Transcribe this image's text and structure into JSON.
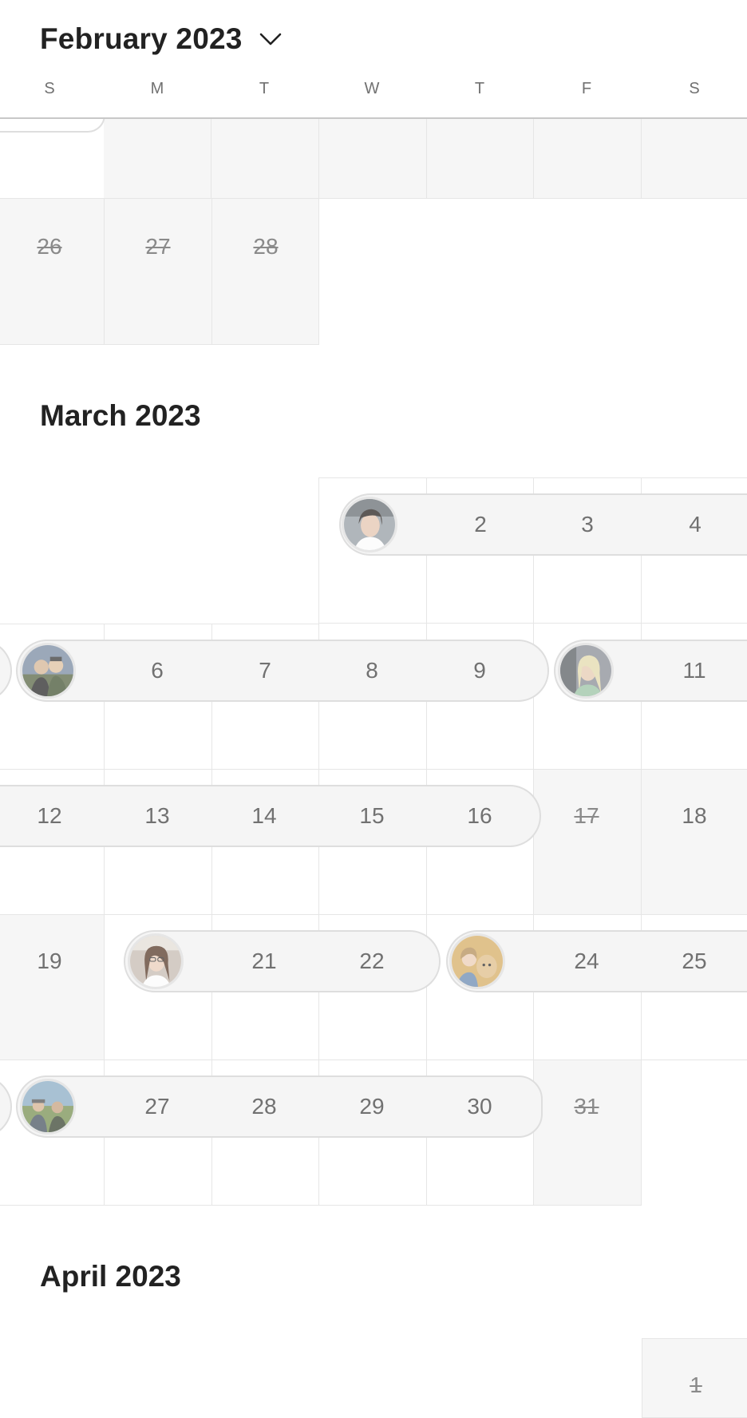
{
  "header": {
    "current_month": "February 2023",
    "weekdays": [
      "S",
      "M",
      "T",
      "W",
      "T",
      "F",
      "S"
    ]
  },
  "months": {
    "february": {
      "title": "",
      "days": [
        "26",
        "27",
        "28"
      ]
    },
    "march": {
      "title": "March 2023",
      "days": {
        "d2": "2",
        "d3": "3",
        "d4": "4",
        "d6": "6",
        "d7": "7",
        "d8": "8",
        "d9": "9",
        "d11": "11",
        "d12": "12",
        "d13": "13",
        "d14": "14",
        "d15": "15",
        "d16": "16",
        "d17": "17",
        "d18": "18",
        "d19": "19",
        "d21": "21",
        "d22": "22",
        "d24": "24",
        "d25": "25",
        "d27": "27",
        "d28": "28",
        "d29": "29",
        "d30": "30",
        "d31": "31"
      }
    },
    "april": {
      "title": "April 2023",
      "days": {
        "d1": "1"
      }
    }
  },
  "colors": {
    "cell_border": "#e6e6e6",
    "unavailable_bg": "#f6f6f6",
    "pill_bg": "#f5f5f5",
    "day_text": "#717171"
  },
  "icons": {
    "month_picker": "chevron-down-icon",
    "guest_avatar": "avatar"
  }
}
